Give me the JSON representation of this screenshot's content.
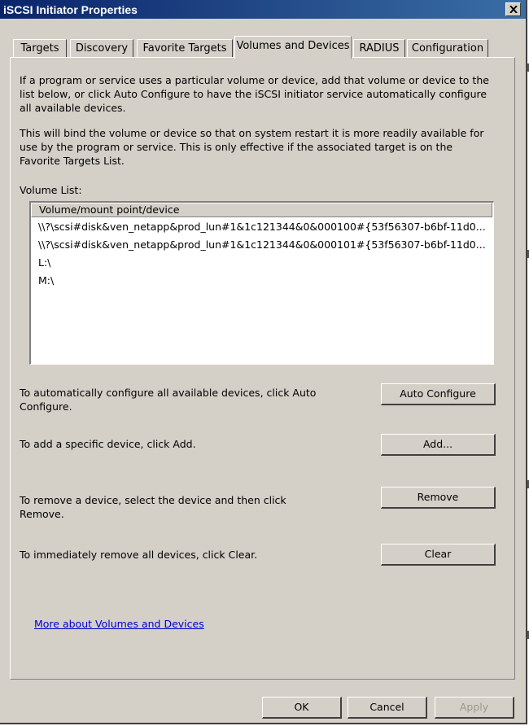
{
  "window": {
    "title": "iSCSI Initiator Properties"
  },
  "tabs": [
    {
      "label": "Targets",
      "active": false
    },
    {
      "label": "Discovery",
      "active": false
    },
    {
      "label": "Favorite Targets",
      "active": false
    },
    {
      "label": "Volumes and Devices",
      "active": true
    },
    {
      "label": "RADIUS",
      "active": false
    },
    {
      "label": "Configuration",
      "active": false
    }
  ],
  "panel": {
    "intro": "If a program or service uses a particular volume or device, add that volume or device to the list below, or click Auto Configure to have the iSCSI initiator service automatically configure all available devices.",
    "bind_note": "This will bind the volume or device so that on system restart it is more readily available for use by the program or service.  This is only effective if the associated target is on the Favorite Targets List.",
    "volume_list_label": "Volume List:",
    "volume_list": {
      "column_header": "Volume/mount point/device",
      "items": [
        "\\\\?\\scsi#disk&ven_netapp&prod_lun#1&1c121344&0&000100#{53f56307-b6bf-11d0...",
        "\\\\?\\scsi#disk&ven_netapp&prod_lun#1&1c121344&0&000101#{53f56307-b6bf-11d0...",
        "L:\\",
        "M:\\"
      ]
    },
    "auto_configure": {
      "text": "To automatically configure all available devices, click Auto Configure.",
      "button": "Auto Configure"
    },
    "add": {
      "text": "To add a specific device, click Add.",
      "button": "Add..."
    },
    "remove": {
      "text": "To remove a device, select the device and then click Remove.",
      "button": "Remove"
    },
    "clear": {
      "text": "To immediately remove all devices, click Clear.",
      "button": "Clear"
    },
    "help_link": "More about Volumes and Devices"
  },
  "footer": {
    "ok": "OK",
    "cancel": "Cancel",
    "apply": "Apply",
    "apply_enabled": false
  },
  "colors": {
    "titlebar_start": "#0a246a",
    "titlebar_end": "#3a6ea5",
    "face": "#d4d0c8",
    "link": "#0000cc"
  }
}
